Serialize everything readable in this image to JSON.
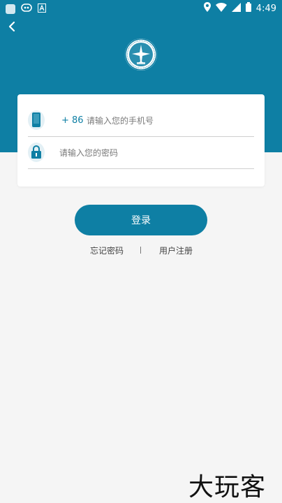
{
  "status_bar": {
    "time": "4:49",
    "left_icons": [
      "app-icon",
      "notification-icon",
      "font-icon"
    ],
    "right_icons": [
      "location-icon",
      "wifi-icon",
      "signal-icon",
      "battery-icon"
    ]
  },
  "header": {
    "back_icon": "chevron-left-icon",
    "logo": "emblem-logo"
  },
  "login": {
    "phone": {
      "icon": "phone-icon",
      "country_code": "+ 86",
      "placeholder": "请输入您的手机号",
      "value": ""
    },
    "password": {
      "icon": "lock-icon",
      "placeholder": "请输入您的密码",
      "value": ""
    },
    "submit_label": "登录"
  },
  "links": {
    "forgot": "忘记密码",
    "divider": "|",
    "register": "用户注册"
  },
  "watermark": "大玩客",
  "colors": {
    "primary": "#0e7fa4",
    "background": "#f5f5f5",
    "card": "#ffffff"
  }
}
